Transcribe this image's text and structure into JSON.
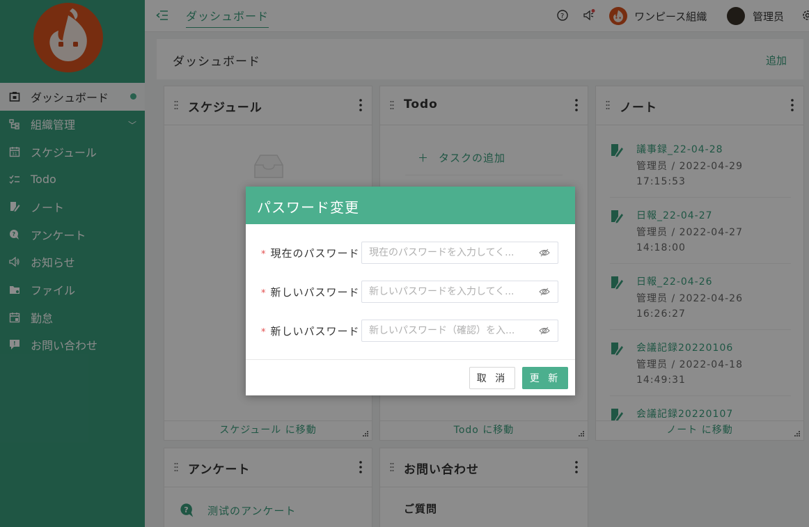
{
  "sidebar": {
    "items": [
      {
        "label": "ダッシュボード",
        "icon": "dashboard-icon"
      },
      {
        "label": "組織管理",
        "icon": "organization-icon"
      },
      {
        "label": "スケジュール",
        "icon": "calendar-icon"
      },
      {
        "label": "Todo",
        "icon": "checklist-icon"
      },
      {
        "label": "ノート",
        "icon": "note-icon"
      },
      {
        "label": "アンケート",
        "icon": "survey-icon"
      },
      {
        "label": "お知らせ",
        "icon": "megaphone-icon"
      },
      {
        "label": "ファイル",
        "icon": "folder-icon"
      },
      {
        "label": "勤怠",
        "icon": "attendance-icon"
      },
      {
        "label": "お問い合わせ",
        "icon": "inquiry-icon"
      }
    ]
  },
  "header": {
    "breadcrumb": "ダッシュボード",
    "org_name": "ワンピース組織",
    "user_name": "管理员"
  },
  "page": {
    "title": "ダッシュボード",
    "add_label": "追加"
  },
  "cards": {
    "schedule": {
      "title": "スケジュール",
      "footer": "スケジュール に移動"
    },
    "todo": {
      "title": "Todo",
      "add_task": "タスクの追加",
      "footer": "Todo に移動"
    },
    "notes": {
      "title": "ノート",
      "footer": "ノート に移動",
      "items": [
        {
          "title": "議事録_22-04-28",
          "meta": "管理员 / 2022-04-29 17:15:53"
        },
        {
          "title": "日報_22-04-27",
          "meta": "管理员 / 2022-04-27 14:18:00"
        },
        {
          "title": "日報_22-04-26",
          "meta": "管理员 / 2022-04-26 16:26:27"
        },
        {
          "title": "会議記録20220106",
          "meta": "管理员 / 2022-04-18 14:49:31"
        },
        {
          "title": "会議記録20220107",
          "meta": ""
        }
      ]
    },
    "survey": {
      "title": "アンケート",
      "item": "测试のアンケート"
    },
    "inquiry": {
      "title": "お問い合わせ",
      "item": "ご質問"
    }
  },
  "dialog": {
    "title": "パスワード変更",
    "fields": [
      {
        "label": "現在のパスワード",
        "placeholder": "現在のパスワードを入力してく..."
      },
      {
        "label": "新しいパスワード",
        "placeholder": "新しいパスワードを入力してく..."
      },
      {
        "label": "新しいパスワード",
        "placeholder": "新しいパスワード（確認）を入..."
      }
    ],
    "cancel_label": "取 消",
    "submit_label": "更 新"
  },
  "colors": {
    "primary": "#3a9d7d",
    "dialog_header": "#4caf8e",
    "required": "#e24d4d"
  }
}
